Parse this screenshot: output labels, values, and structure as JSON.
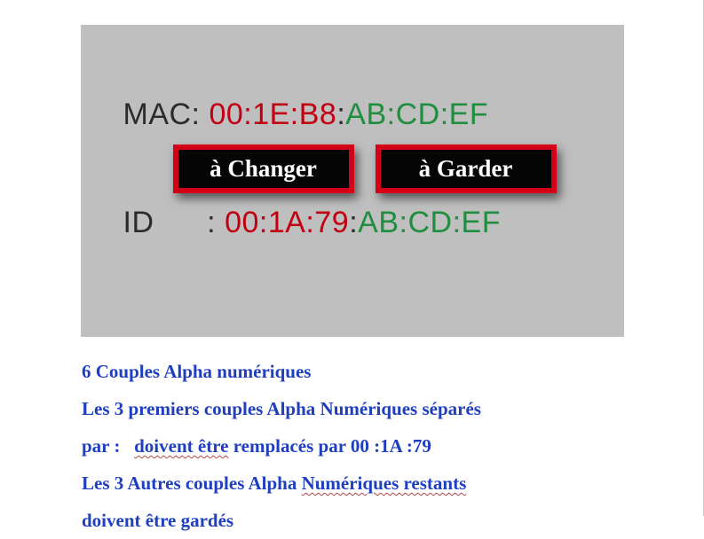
{
  "diagram": {
    "mac": {
      "label": "MAC: ",
      "red_part": "00:1E:B8",
      "sep": ":",
      "green_part": "AB:CD:EF"
    },
    "id": {
      "label": "ID",
      "label_sep": " : ",
      "red_part": "00:1A:79",
      "sep": ":",
      "green_part": "AB:CD:EF"
    },
    "btn_change": "à Changer",
    "btn_keep": "à  Garder"
  },
  "instructions": {
    "line1": "6 Couples Alpha numériques",
    "line2": "Les 3 premiers couples Alpha Numériques séparés",
    "line3_pre": "par :   ",
    "line3_wavy": "doivent  être",
    "line3_post": " remplacés  par 00 :1A :79",
    "line4_pre": "Les 3 Autres couples Alpha ",
    "line4_wavy": "Numériques  restants",
    "line5": "doivent être gardés"
  }
}
